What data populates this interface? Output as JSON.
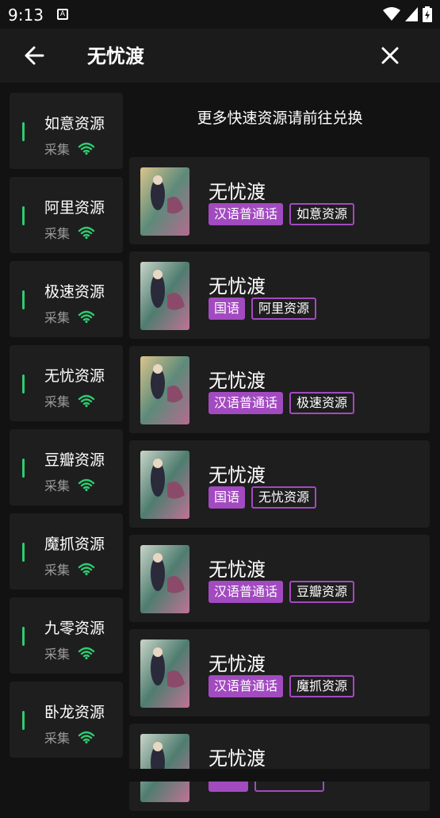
{
  "status": {
    "time": "9:13",
    "a_icon": "A"
  },
  "appbar": {
    "title": "无忧渡"
  },
  "sources": [
    {
      "name": "如意资源",
      "sub": "采集"
    },
    {
      "name": "阿里资源",
      "sub": "采集"
    },
    {
      "name": "极速资源",
      "sub": "采集"
    },
    {
      "name": "无忧资源",
      "sub": "采集"
    },
    {
      "name": "豆瓣资源",
      "sub": "采集"
    },
    {
      "name": "魔抓资源",
      "sub": "采集"
    },
    {
      "name": "九零资源",
      "sub": "采集"
    },
    {
      "name": "卧龙资源",
      "sub": "采集"
    }
  ],
  "notice": "更多快速资源请前往兑换",
  "results": [
    {
      "title": "无忧渡",
      "lang": "汉语普通话",
      "source": "如意资源"
    },
    {
      "title": "无忧渡",
      "lang": "国语",
      "source": "阿里资源"
    },
    {
      "title": "无忧渡",
      "lang": "汉语普通话",
      "source": "极速资源"
    },
    {
      "title": "无忧渡",
      "lang": "国语",
      "source": "无忧资源"
    },
    {
      "title": "无忧渡",
      "lang": "汉语普通话",
      "source": "豆瓣资源"
    },
    {
      "title": "无忧渡",
      "lang": "汉语普通话",
      "source": "魔抓资源"
    },
    {
      "title": "无忧渡",
      "lang": "",
      "source": ""
    }
  ],
  "colors": {
    "accent": "#a24ac0",
    "signal": "#2ecc71",
    "bg": "#121212",
    "card": "#1e1e1e"
  }
}
